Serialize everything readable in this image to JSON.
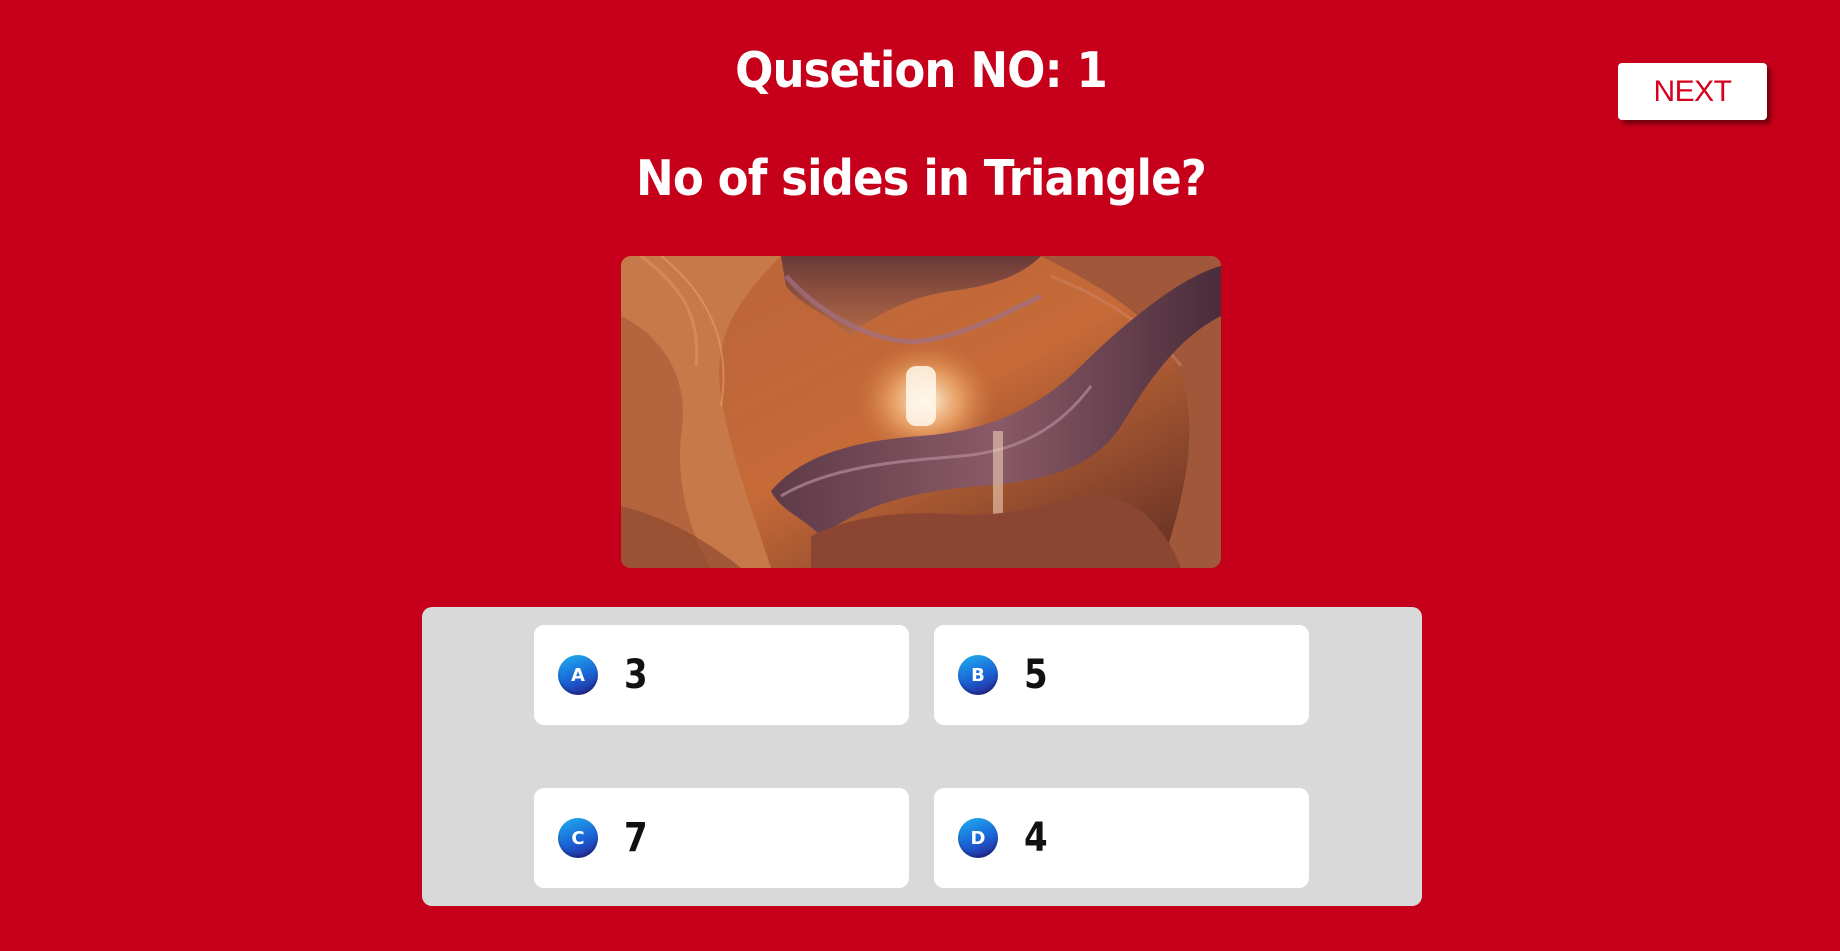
{
  "header": {
    "question_number_label": "Qusetion NO: 1"
  },
  "question": {
    "text": "No of sides in Triangle?",
    "image_icon": "canyon-photo"
  },
  "toolbar": {
    "next_label": "NEXT"
  },
  "options": [
    {
      "letter": "A",
      "text": "3"
    },
    {
      "letter": "B",
      "text": "5"
    },
    {
      "letter": "C",
      "text": "7"
    },
    {
      "letter": "D",
      "text": "4"
    }
  ],
  "colors": {
    "background": "#c6001a",
    "panel": "#d9d9d9",
    "next_text": "#d6001f",
    "badge_gradient_start": "#1fb2f0",
    "badge_gradient_end": "#2a1b8a"
  }
}
